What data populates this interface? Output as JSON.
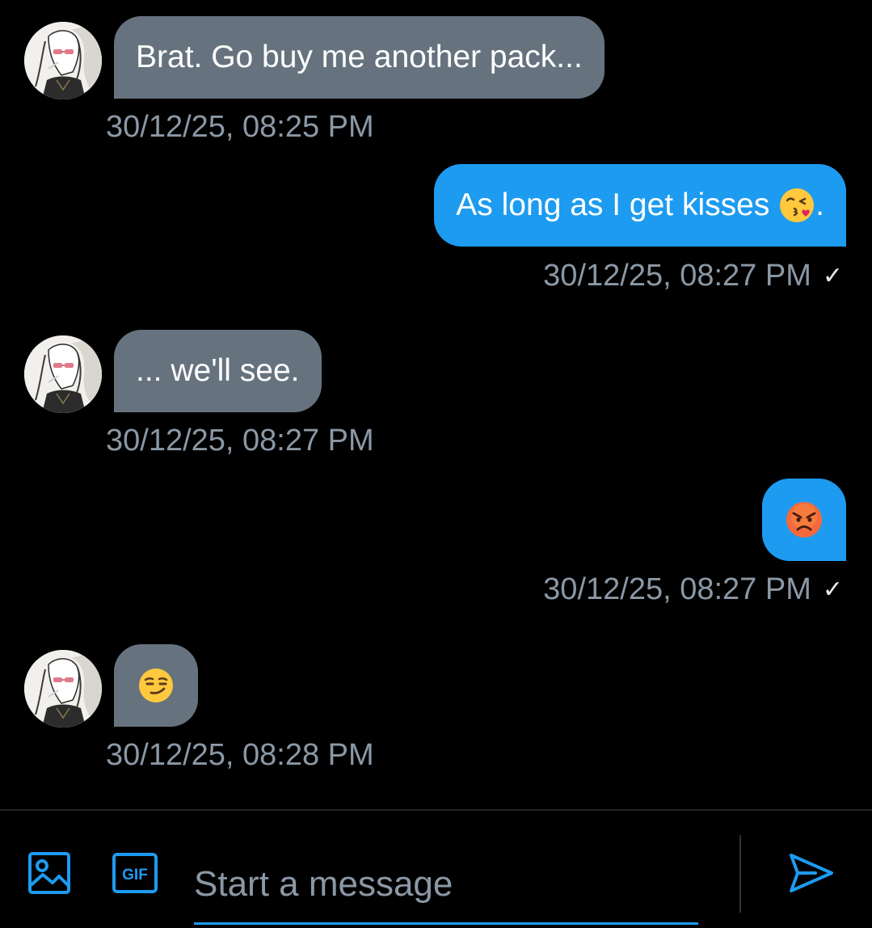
{
  "messages": [
    {
      "direction": "incoming",
      "text": "Brat. Go buy me another pack...",
      "timestamp": "30/12/25, 08:25 PM"
    },
    {
      "direction": "outgoing",
      "text": "As long as I get kisses ",
      "emoji": "face-blowing-a-kiss",
      "text_after": ".",
      "timestamp": "30/12/25, 08:27 PM",
      "status": "✓"
    },
    {
      "direction": "incoming",
      "text": "... we'll see.",
      "timestamp": "30/12/25, 08:27 PM"
    },
    {
      "direction": "outgoing",
      "emoji": "angry-face",
      "timestamp": "30/12/25, 08:27 PM",
      "status": "✓"
    },
    {
      "direction": "incoming",
      "emoji": "smirking-face",
      "timestamp": "30/12/25, 08:28 PM"
    }
  ],
  "composer": {
    "placeholder": "Start a message",
    "gif_label": "GIF",
    "icons": [
      "image-icon",
      "gif-icon",
      "send-icon"
    ]
  },
  "colors": {
    "background": "#000000",
    "incoming_bubble": "#66737f",
    "outgoing_bubble": "#1d9bf0",
    "timestamp": "#8b98a5",
    "accent": "#1d9bf0"
  }
}
